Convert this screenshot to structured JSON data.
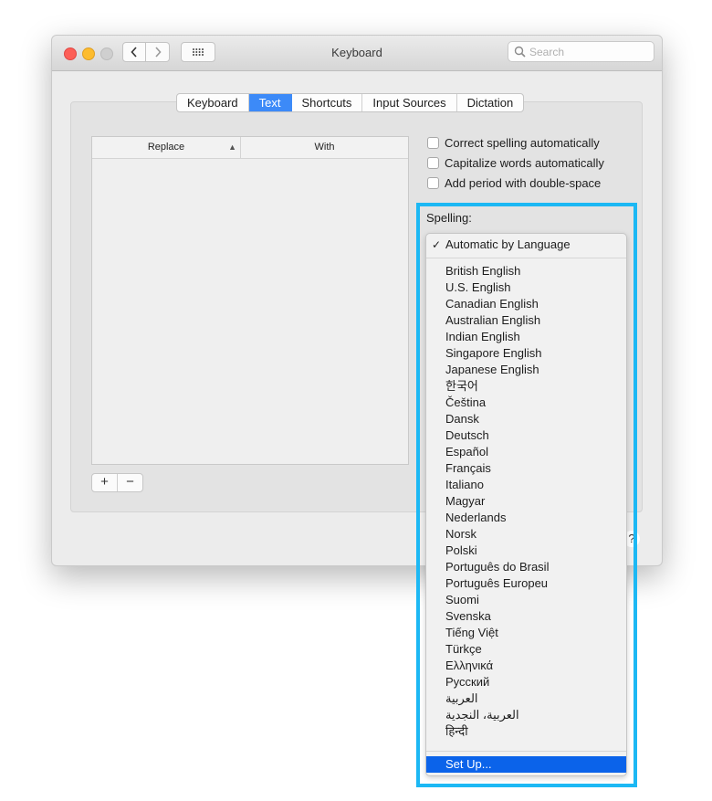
{
  "window": {
    "title": "Keyboard"
  },
  "search": {
    "placeholder": "Search"
  },
  "tabs": [
    "Keyboard",
    "Text",
    "Shortcuts",
    "Input Sources",
    "Dictation"
  ],
  "active_tab": "Text",
  "table": {
    "col_replace": "Replace",
    "col_with": "With"
  },
  "table_buttons": {
    "add": "+",
    "remove": "−"
  },
  "options": [
    {
      "label": "Correct spelling automatically",
      "checked": false
    },
    {
      "label": "Capitalize words automatically",
      "checked": false
    },
    {
      "label": "Add period with double-space",
      "checked": false
    }
  ],
  "spelling": {
    "label": "Spelling:",
    "selected": "Automatic by Language",
    "languages": [
      "British English",
      "U.S. English",
      "Canadian English",
      "Australian English",
      "Indian English",
      "Singapore English",
      "Japanese English",
      "한국어",
      "Čeština",
      "Dansk",
      "Deutsch",
      "Español",
      "Français",
      "Italiano",
      "Magyar",
      "Nederlands",
      "Norsk",
      "Polski",
      "Português do Brasil",
      "Português Europeu",
      "Suomi",
      "Svenska",
      "Tiếng Việt",
      "Türkçe",
      "Ελληνικά",
      "Русский",
      "العربية",
      "العربية، النجدية",
      "हिन्दी"
    ],
    "setup": "Set Up..."
  },
  "help": "?",
  "colors": {
    "accent": "#3c8af8",
    "highlight_border": "#1cb8f4",
    "menu_selection": "#0b63ea"
  }
}
